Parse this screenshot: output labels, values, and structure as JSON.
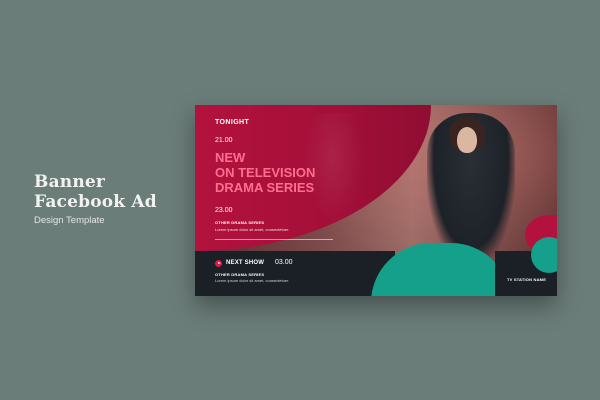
{
  "caption": {
    "line1": "Banner",
    "line2": "Facebook Ad",
    "line3": "Design Template"
  },
  "banner": {
    "tonight": "TONIGHT",
    "time_first": "21.00",
    "headline": [
      "NEW",
      "ON TELEVISION",
      "DRAMA SERIES"
    ],
    "time_second": "23.00",
    "series_label": "OTHER DRAMA SERIES",
    "lorem": "Lorem ipsum dolor sit amet, consectetuer.",
    "next_show": "NEXT SHOW",
    "time_next": "03.00",
    "series_label_2": "OTHER DRAMA SERIES",
    "lorem_2": "Lorem ipsum dolor sit amet, consectetuer.",
    "station": "TV STATION NAME"
  },
  "colors": {
    "background": "#6b7d79",
    "brand_red": "#b3123e",
    "headline_pink": "#ff6f8f",
    "teal": "#14a08b",
    "dark": "#1b1f26"
  },
  "icons": {
    "play": "play-circle-icon"
  }
}
